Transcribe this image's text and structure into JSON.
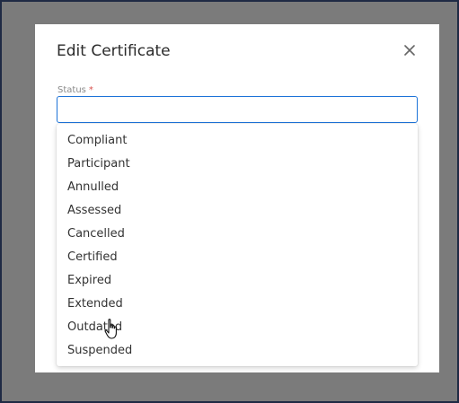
{
  "dialog": {
    "title": "Edit Certificate",
    "close_icon": "close-icon"
  },
  "field": {
    "label": "Status",
    "required_mark": "*",
    "value": "",
    "focused_color": "#1d73d8"
  },
  "dropdown": {
    "options": [
      "Compliant",
      "Participant",
      "Annulled",
      "Assessed",
      "Cancelled",
      "Certified",
      "Expired",
      "Extended",
      "Outdated",
      "Suspended"
    ]
  },
  "pointer": {
    "icon": "hand-pointer-icon"
  }
}
